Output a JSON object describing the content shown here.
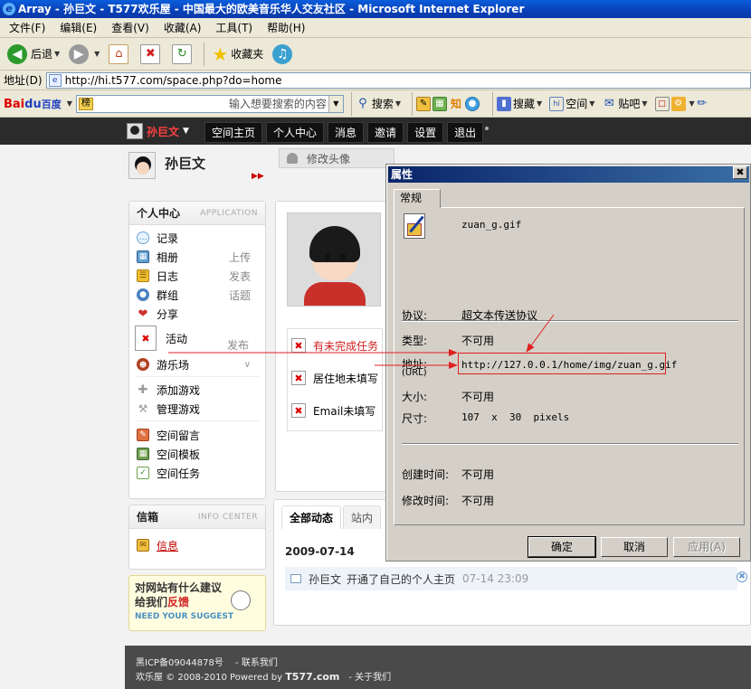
{
  "window": {
    "title": "Array - 孙巨文 - T577欢乐屋 - 中国最大的欧美音乐华人交友社区 - Microsoft Internet Explorer"
  },
  "menu": [
    "文件(F)",
    "编辑(E)",
    "查看(V)",
    "收藏(A)",
    "工具(T)",
    "帮助(H)"
  ],
  "toolbar": {
    "back": "后退",
    "favorites": "收藏夹"
  },
  "address": {
    "label": "地址(D)",
    "url": "http://hi.t577.com/space.php?do=home"
  },
  "baidu": {
    "logo_red": "Bai",
    "logo_blue": "du",
    "logo_rest": "百度",
    "tag": "榜",
    "placeholder": "输入想要搜索的内容",
    "search": "搜索",
    "zhi": "知",
    "collect": "搜藏",
    "space": "空间",
    "tieba": "贴吧"
  },
  "site": {
    "username": "孙巨文",
    "nav": [
      "空间主页",
      "个人中心",
      "消息",
      "邀请",
      "设置",
      "退出"
    ],
    "edit_avatar": "修改头像"
  },
  "app_panel": {
    "title": "个人中心",
    "subtitle": "APPLICATION",
    "items": {
      "record": "记录",
      "album": "相册",
      "album_side": "上传",
      "blog": "日志",
      "blog_side": "发表",
      "group": "群组",
      "group_side": "话题",
      "share": "分享",
      "activity": "活动",
      "activity_side": "发布",
      "games": "游乐场",
      "add_game": "添加游戏",
      "manage_game": "管理游戏",
      "guestbook": "空间留言",
      "template": "空间模板",
      "tasks": "空间任务"
    }
  },
  "info_panel": {
    "title": "信箱",
    "subtitle": "INFO CENTER",
    "message": "信息"
  },
  "suggest": {
    "line1": "对网站有什么建议",
    "line2a": "给我们",
    "line2b": "反馈",
    "line3": "NEED YOUR SUGGEST"
  },
  "tasks": {
    "t1": "有未完成任务",
    "t2": "居住地未填写",
    "t3": "Email未填写"
  },
  "feed": {
    "tab_all": "全部动态",
    "tab_site": "站内",
    "date": "2009-07-14",
    "user": "孙巨文",
    "text": "开通了自己的个人主页",
    "time": "07-14 23:09"
  },
  "footer": {
    "line1": "黑ICP备09044878号　 - 联系我们",
    "line2a": "欢乐屋 © 2008-2010 Powered by ",
    "line2b": "T577.com",
    "line2c": "　- 关于我们"
  },
  "dialog": {
    "title": "属性",
    "tab": "常规",
    "filename": "zuan_g.gif",
    "protocol_label": "协议:",
    "protocol_value": "超文本传送协议",
    "type_label": "类型:",
    "type_value": "不可用",
    "address_label": "地址:",
    "address_label_en": "(URL)",
    "address_value": "http://127.0.0.1/home/img/zuan_g.gif",
    "size_label": "大小:",
    "size_value": "不可用",
    "dims_label": "尺寸:",
    "dims_value": "107  x  30  pixels",
    "created_label": "创建时间:",
    "created_value": "不可用",
    "modified_label": "修改时间:",
    "modified_value": "不可用",
    "ok": "确定",
    "cancel": "取消",
    "apply": "应用(A)"
  },
  "colors": {
    "annotation": "#e02020",
    "site_topbar": "#2b2b2b",
    "dialog_title": "#0a246a"
  }
}
